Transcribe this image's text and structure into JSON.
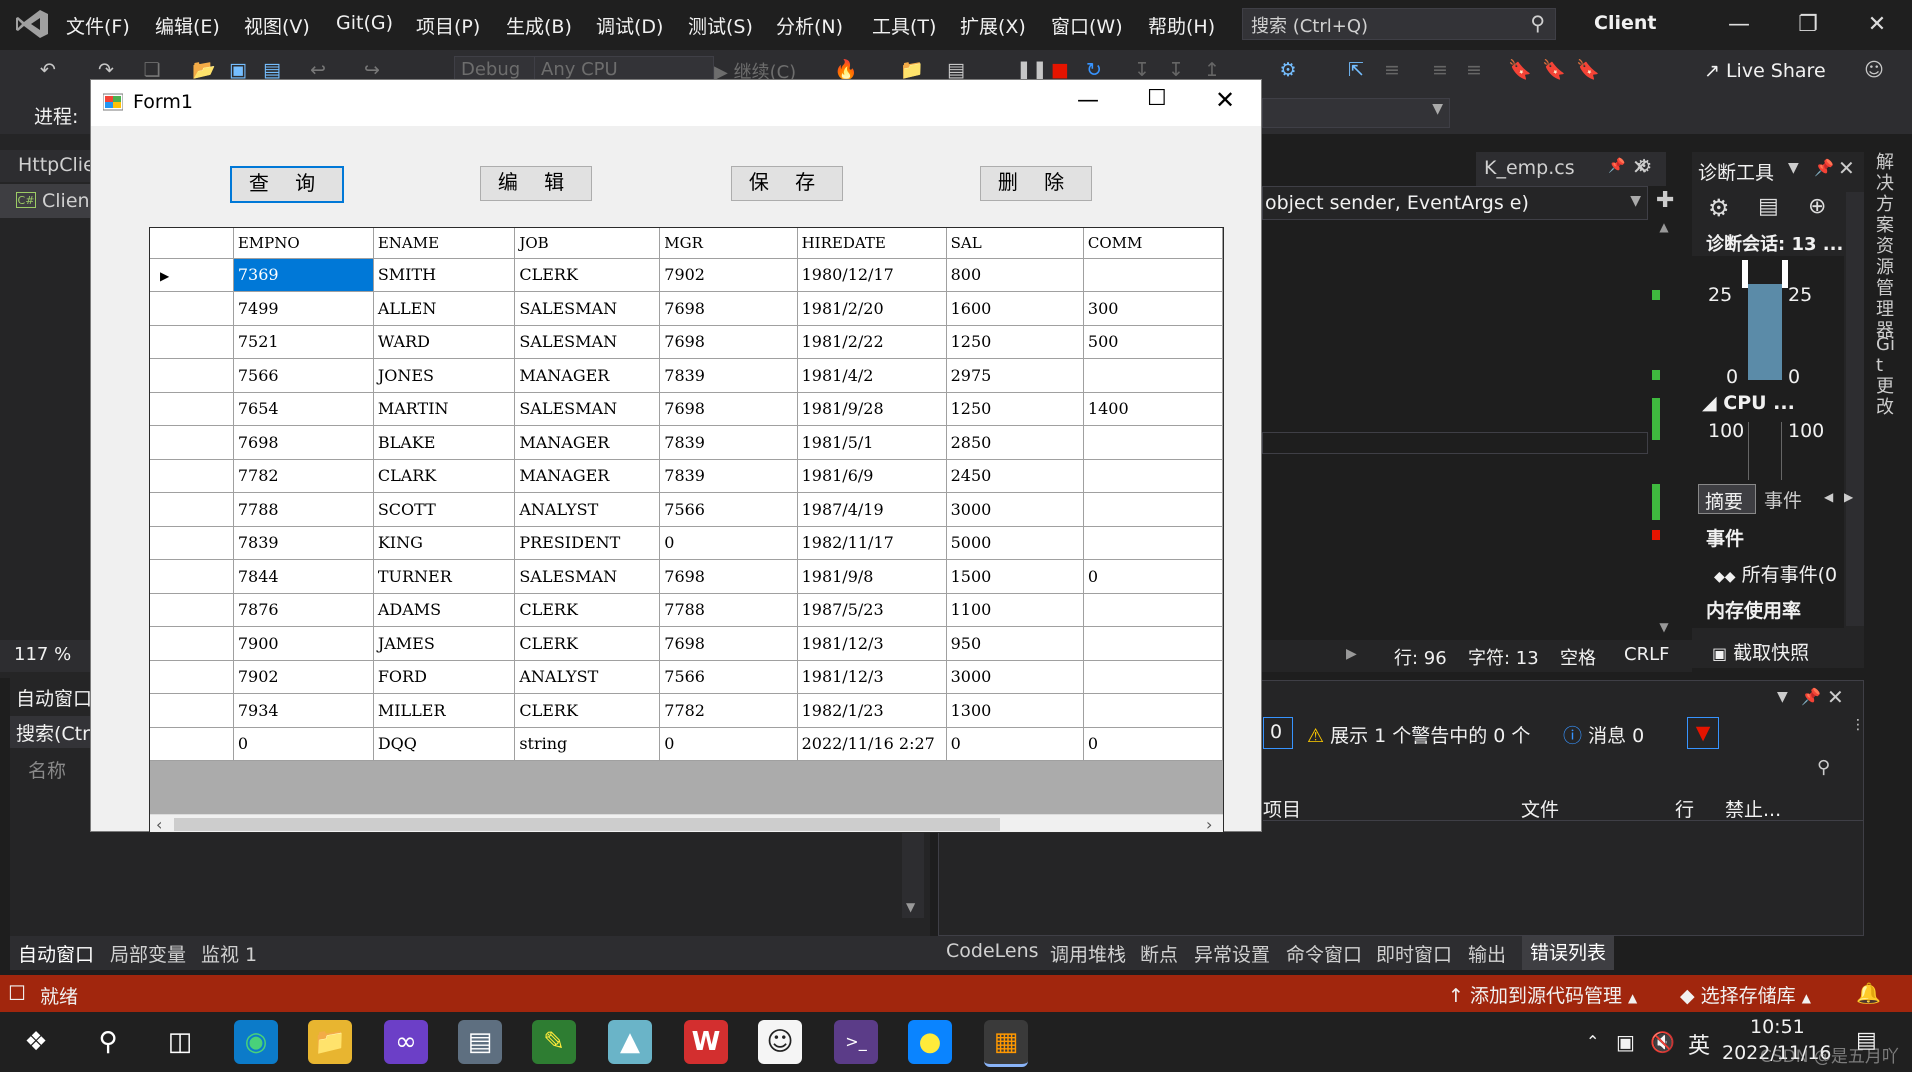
{
  "vs": {
    "menu": [
      "文件(F)",
      "编辑(E)",
      "视图(V)",
      "Git(G)",
      "项目(P)",
      "生成(B)",
      "调试(D)",
      "测试(S)",
      "分析(N)",
      "工具(T)",
      "扩展(X)",
      "窗口(W)",
      "帮助(H)"
    ],
    "search_placeholder": "搜索 (Ctrl+Q)",
    "solution_name": "Client",
    "debug_config": "Debug",
    "platform": "Any CPU",
    "continue_label": "继续(C)",
    "live_share": "Live Share",
    "process_label": "进程:",
    "left_tabs": [
      "HttpClie",
      "Client"
    ],
    "zoom": "117 %",
    "editor_tab": "K_emp.cs",
    "method_combo": "object sender, EventArgs e)",
    "diagnostics": {
      "title": "诊断工具",
      "session": "诊断会话: 13 ...",
      "mem_top_left": "25",
      "mem_top_right": "25",
      "mem_bottom_left": "0",
      "mem_bottom_right": "0",
      "cpu_label": "CPU ...",
      "cpu_left": "100",
      "cpu_right": "100",
      "tab_summary": "摘要",
      "tab_events": "事件",
      "events_header": "事件",
      "all_events": "所有事件(0",
      "memory_header": "内存使用率",
      "snapshot": "截取快照"
    },
    "side_vertical": [
      "解决方案资源管理器",
      "Git 更改"
    ],
    "editor_status": {
      "line": "行: 96",
      "col": "字符: 13",
      "space": "空格",
      "eol": "CRLF"
    },
    "auto_window": {
      "title": "自动窗口",
      "search": "搜索(Ctr",
      "col_name": "名称"
    },
    "error_list": {
      "errors_count": "0",
      "warnings": "展示 1 个警告中的 0 个",
      "messages": "消息 0",
      "col_project": "项目",
      "col_file": "文件",
      "col_line": "行",
      "col_suppress": "禁止..."
    },
    "bottom_left_tabs": [
      "自动窗口",
      "局部变量",
      "监视 1"
    ],
    "bottom_right_tabs": [
      "CodeLens",
      "调用堆栈",
      "断点",
      "异常设置",
      "命令窗口",
      "即时窗口",
      "输出",
      "错误列表"
    ],
    "status": {
      "ready": "就绪",
      "add_source": "添加到源代码管理",
      "select_repo": "选择存储库"
    }
  },
  "taskbar": {
    "time": "10:51",
    "date": "2022/11/16",
    "ime": "英",
    "watermark": "CSDN @是五月吖"
  },
  "form1": {
    "title": "Form1",
    "buttons": {
      "query": "查 询",
      "edit": "编 辑",
      "save": "保 存",
      "delete": "删 除"
    },
    "columns": [
      "EMPNO",
      "ENAME",
      "JOB",
      "MGR",
      "HIREDATE",
      "SAL",
      "COMM"
    ],
    "rows": [
      [
        "7369",
        "SMITH",
        "CLERK",
        "7902",
        "1980/12/17",
        "800",
        ""
      ],
      [
        "7499",
        "ALLEN",
        "SALESMAN",
        "7698",
        "1981/2/20",
        "1600",
        "300"
      ],
      [
        "7521",
        "WARD",
        "SALESMAN",
        "7698",
        "1981/2/22",
        "1250",
        "500"
      ],
      [
        "7566",
        "JONES",
        "MANAGER",
        "7839",
        "1981/4/2",
        "2975",
        ""
      ],
      [
        "7654",
        "MARTIN",
        "SALESMAN",
        "7698",
        "1981/9/28",
        "1250",
        "1400"
      ],
      [
        "7698",
        "BLAKE",
        "MANAGER",
        "7839",
        "1981/5/1",
        "2850",
        ""
      ],
      [
        "7782",
        "CLARK",
        "MANAGER",
        "7839",
        "1981/6/9",
        "2450",
        ""
      ],
      [
        "7788",
        "SCOTT",
        "ANALYST",
        "7566",
        "1987/4/19",
        "3000",
        ""
      ],
      [
        "7839",
        "KING",
        "PRESIDENT",
        "0",
        "1982/11/17",
        "5000",
        ""
      ],
      [
        "7844",
        "TURNER",
        "SALESMAN",
        "7698",
        "1981/9/8",
        "1500",
        "0"
      ],
      [
        "7876",
        "ADAMS",
        "CLERK",
        "7788",
        "1987/5/23",
        "1100",
        ""
      ],
      [
        "7900",
        "JAMES",
        "CLERK",
        "7698",
        "1981/12/3",
        "950",
        ""
      ],
      [
        "7902",
        "FORD",
        "ANALYST",
        "7566",
        "1981/12/3",
        "3000",
        ""
      ],
      [
        "7934",
        "MILLER",
        "CLERK",
        "7782",
        "1982/1/23",
        "1300",
        ""
      ],
      [
        "0",
        "DQQ",
        "string",
        "0",
        "2022/11/16 2:27",
        "0",
        "0"
      ]
    ]
  }
}
